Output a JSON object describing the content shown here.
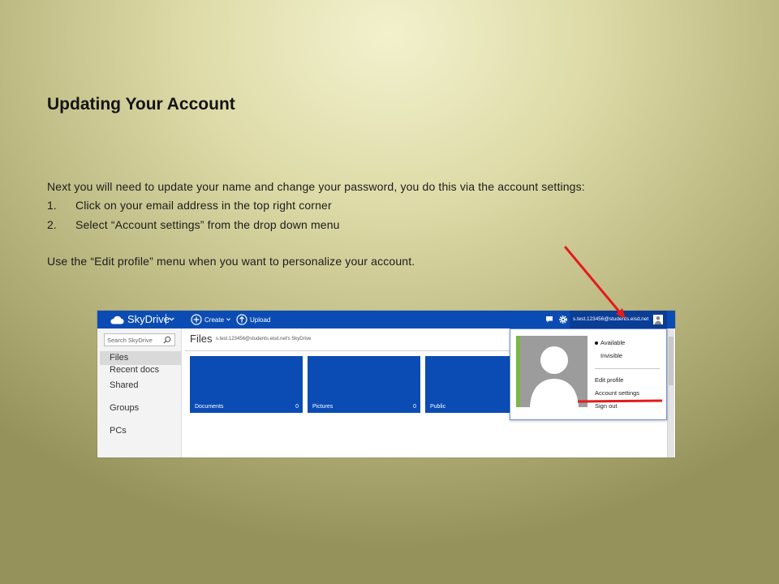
{
  "slide": {
    "title": "Updating Your Account",
    "intro": "Next you will need to update your name and change your password, you do this via the account settings:",
    "steps": [
      {
        "number": "1.",
        "text": "Click on your email address in the top right corner"
      },
      {
        "number": "2.",
        "text": "Select “Account settings” from the drop down menu"
      }
    ],
    "note": "Use the “Edit profile” menu when you want to personalize your account."
  },
  "skydrive": {
    "brand": "SkyDrive",
    "create_label": "Create",
    "upload_label": "Upload",
    "account_email": "s.test.123456@students.eisd.net",
    "search_placeholder": "Search SkyDrive",
    "nav": [
      {
        "label": "Files",
        "selected": true
      },
      {
        "label": "Recent docs"
      },
      {
        "label": "Shared"
      },
      {
        "label": "Groups"
      },
      {
        "label": "PCs"
      }
    ],
    "page_title": "Files",
    "breadcrumb": "s.test.123456@students.eisd.net's SkyDrive",
    "tiles": [
      {
        "name": "Documents",
        "count": "0"
      },
      {
        "name": "Pictures",
        "count": "0"
      },
      {
        "name": "Public"
      }
    ],
    "account_menu": {
      "available": "Available",
      "invisible": "Invisible",
      "edit_profile": "Edit profile",
      "account_settings": "Account settings",
      "sign_out": "Sign out"
    },
    "icons": [
      "cloud-icon",
      "chevron-down-icon",
      "plus-circle-icon",
      "upload-icon",
      "chat-icon",
      "gear-icon",
      "user-avatar-icon",
      "search-icon"
    ]
  },
  "colors": {
    "skydrive_blue": "#0b4cb4",
    "account_blue": "#0a3e96",
    "annotation_red": "#e31b1b",
    "presence_green": "#78b843"
  }
}
